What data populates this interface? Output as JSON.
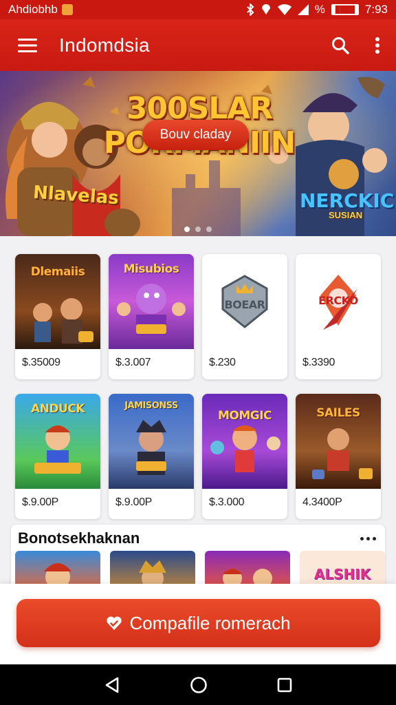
{
  "status_bar": {
    "left_text": "Ahdiobhb",
    "percent_symbol": "%",
    "time": "7:93",
    "battery_text": "████"
  },
  "app_bar": {
    "title": "Indomdsia",
    "icons": [
      "menu-icon",
      "search-icon",
      "more-vert-icon"
    ]
  },
  "banner": {
    "title_line1": "300SLAR",
    "title_line2": "PORMANIIN",
    "button_label": "Bouv claday",
    "left_tag": "Nlavelas",
    "right_tag": "NERCKIC",
    "right_subtag": "SUSIAN",
    "slides": 3,
    "active_slide": 0
  },
  "games_row1": [
    {
      "caption": "Dlemaiis",
      "price": "$.35009"
    },
    {
      "caption": "Misubios",
      "price": "$.3.007"
    },
    {
      "caption": "BOEAR",
      "price": "$.230"
    },
    {
      "caption": "ERCKO",
      "price": "$.3390"
    }
  ],
  "games_row2": [
    {
      "caption": "ANDUCK",
      "price": "$.9.00P"
    },
    {
      "caption": "JAMISONSS",
      "price": "$.9.00P"
    },
    {
      "caption": "MOMGIC",
      "price": "$.3.000"
    },
    {
      "caption": "SAILES",
      "price": "4.3400P"
    }
  ],
  "section": {
    "title": "Bonotsekhaknan",
    "mini_caption": "ALSHIK"
  },
  "cta": {
    "label": "Compafile romerach",
    "icon": "heart-check-icon"
  },
  "nav_bar": {
    "icons": [
      "back-icon",
      "home-icon",
      "recents-icon"
    ]
  },
  "colors": {
    "brand_red": "#c8180f",
    "cta_red": "#e2401f",
    "banner_title": "#ffc533"
  }
}
